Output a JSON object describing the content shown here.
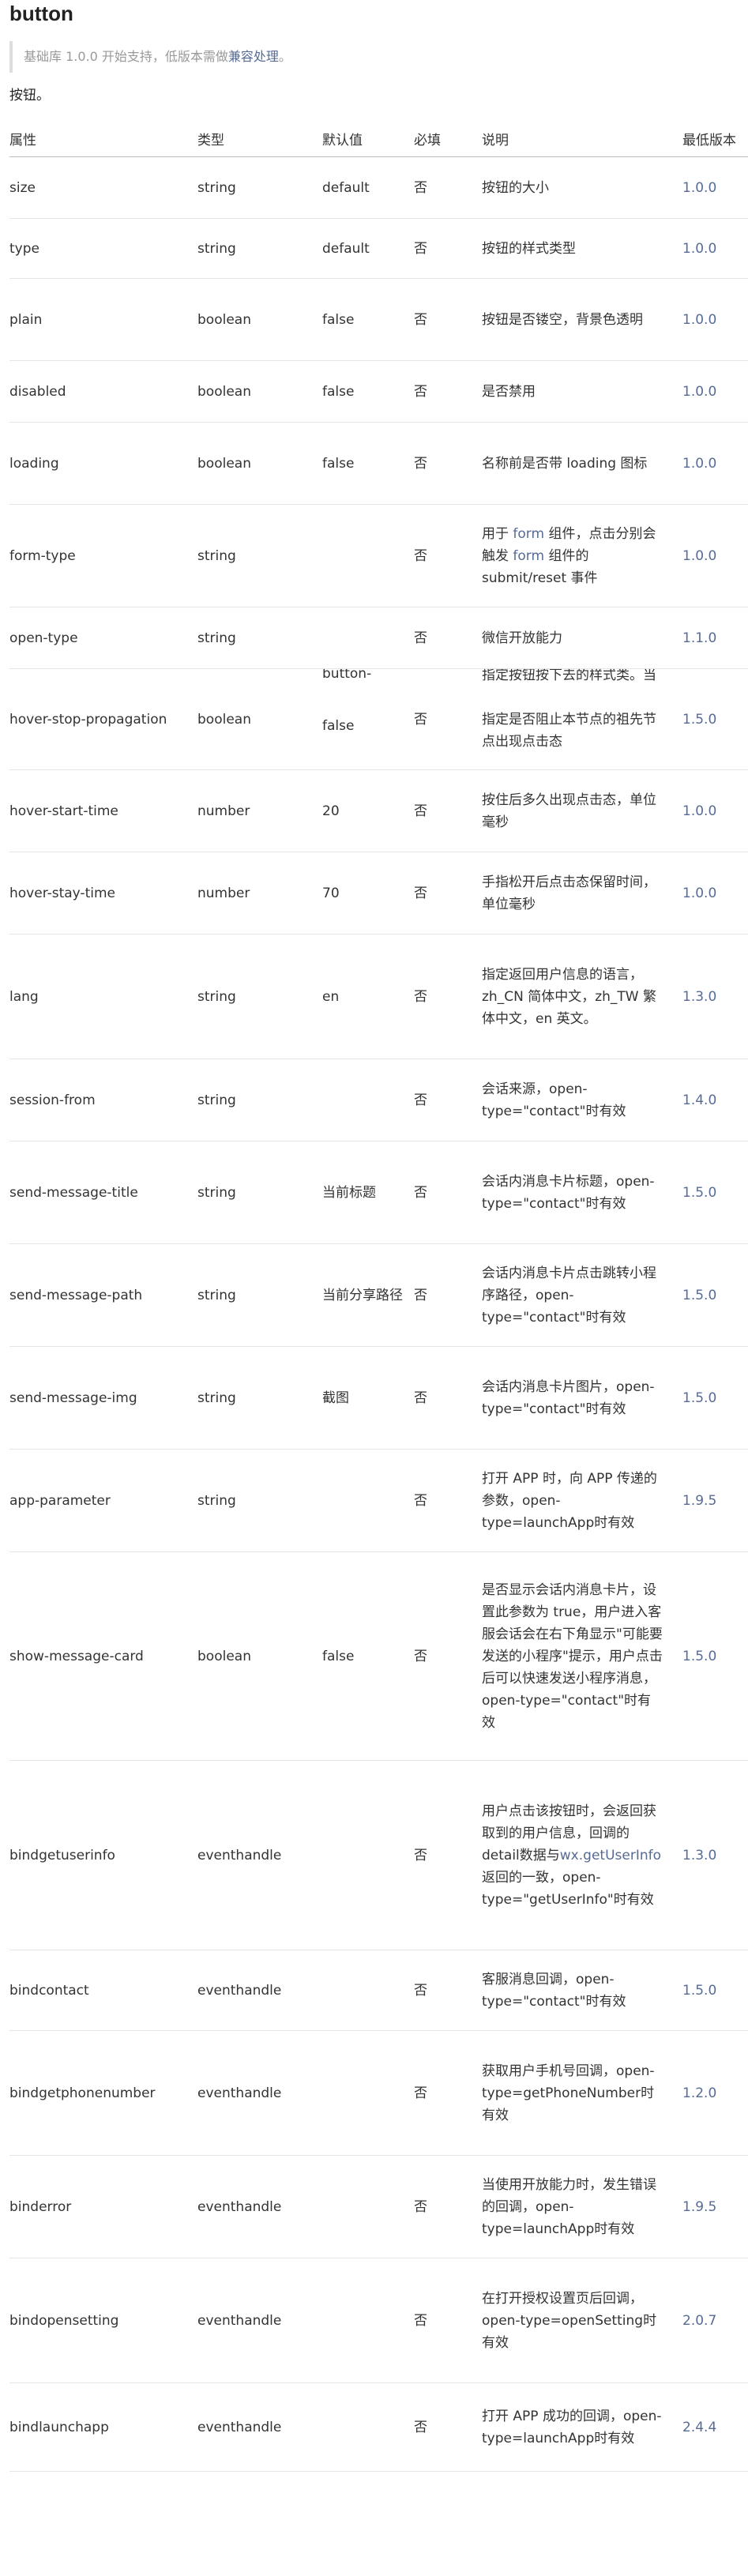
{
  "title": "button",
  "note": {
    "prefix": "基础库 1.0.0 开始支持，低版本需做",
    "link": "兼容处理",
    "suffix": "。"
  },
  "intro": "按钮。",
  "headers": [
    "属性",
    "类型",
    "默认值",
    "必填",
    "说明",
    "最低版本"
  ],
  "rows": [
    {
      "name": "size",
      "type": "string",
      "def": "default",
      "req": "否",
      "desc": "按钮的大小",
      "ver": "1.0.0"
    },
    {
      "name": "type",
      "type": "string",
      "def": "default",
      "req": "否",
      "desc": "按钮的样式类型",
      "ver": "1.0.0"
    },
    {
      "name": "plain",
      "type": "boolean",
      "def": "false",
      "req": "否",
      "desc": "按钮是否镂空，背景色透明",
      "ver": "1.0.0"
    },
    {
      "name": "disabled",
      "type": "boolean",
      "def": "false",
      "req": "否",
      "desc": "是否禁用",
      "ver": "1.0.0"
    },
    {
      "name": "loading",
      "type": "boolean",
      "def": "false",
      "req": "否",
      "desc": "名称前是否带 loading 图标",
      "ver": "1.0.0"
    },
    {
      "name": "form-type",
      "type": "string",
      "def": "",
      "req": "否",
      "desc_parts": [
        "用于 ",
        "form",
        " 组件，点击分别会触发 ",
        "form",
        " 组件的 submit/reset 事件"
      ],
      "ver": "1.0.0"
    },
    {
      "name": "open-type",
      "type": "string",
      "def": "",
      "req": "否",
      "desc": "微信开放能力",
      "ver": "1.1.0"
    },
    {
      "name": "hover-stop-propagation",
      "type": "boolean",
      "def": "false",
      "req": "否",
      "desc": "指定是否阻止本节点的祖先节点出现点击态",
      "ver": "1.5.0",
      "ghost_desc": "指定按钮按下去的样式类。当",
      "ghost_def": "button-"
    },
    {
      "name": "hover-start-time",
      "type": "number",
      "def": "20",
      "req": "否",
      "desc": "按住后多久出现点击态，单位毫秒",
      "ver": "1.0.0"
    },
    {
      "name": "hover-stay-time",
      "type": "number",
      "def": "70",
      "req": "否",
      "desc": "手指松开后点击态保留时间，单位毫秒",
      "ver": "1.0.0"
    },
    {
      "name": "lang",
      "type": "string",
      "def": "en",
      "req": "否",
      "desc": "指定返回用户信息的语言，zh_CN 简体中文，zh_TW 繁体中文，en 英文。",
      "ver": "1.3.0"
    },
    {
      "name": "session-from",
      "type": "string",
      "def": "",
      "req": "否",
      "desc": "会话来源，open-type=\"contact\"时有效",
      "ver": "1.4.0"
    },
    {
      "name": "send-message-title",
      "type": "string",
      "def": "当前标题",
      "req": "否",
      "desc": "会话内消息卡片标题，open-type=\"contact\"时有效",
      "ver": "1.5.0"
    },
    {
      "name": "send-message-path",
      "type": "string",
      "def": "当前分享路径",
      "req": "否",
      "desc": "会话内消息卡片点击跳转小程序路径，open-type=\"contact\"时有效",
      "ver": "1.5.0"
    },
    {
      "name": "send-message-img",
      "type": "string",
      "def": "截图",
      "req": "否",
      "desc": "会话内消息卡片图片，open-type=\"contact\"时有效",
      "ver": "1.5.0"
    },
    {
      "name": "app-parameter",
      "type": "string",
      "def": "",
      "req": "否",
      "desc": "打开 APP 时，向 APP 传递的参数，open-type=launchApp时有效",
      "ver": "1.9.5"
    },
    {
      "name": "show-message-card",
      "type": "boolean",
      "def": "false",
      "req": "否",
      "desc": "是否显示会话内消息卡片，设置此参数为 true，用户进入客服会话会在右下角显示\"可能要发送的小程序\"提示，用户点击后可以快速发送小程序消息，open-type=\"contact\"时有效",
      "ver": "1.5.0"
    },
    {
      "name": "bindgetuserinfo",
      "type": "eventhandle",
      "def": "",
      "req": "否",
      "desc_parts": [
        "用户点击该按钮时，会返回获取到的用户信息，回调的detail数据与",
        "wx.getUserInfo",
        "返回的一致，open-type=\"getUserInfo\"时有效"
      ],
      "ver": "1.3.0"
    },
    {
      "name": "bindcontact",
      "type": "eventhandle",
      "def": "",
      "req": "否",
      "desc": "客服消息回调，open-type=\"contact\"时有效",
      "ver": "1.5.0"
    },
    {
      "name": "bindgetphonenumber",
      "type": "eventhandle",
      "def": "",
      "req": "否",
      "desc": "获取用户手机号回调，open-type=getPhoneNumber时有效",
      "ver": "1.2.0"
    },
    {
      "name": "binderror",
      "type": "eventhandle",
      "def": "",
      "req": "否",
      "desc": "当使用开放能力时，发生错误的回调，open-type=launchApp时有效",
      "ver": "1.9.5"
    },
    {
      "name": "bindopensetting",
      "type": "eventhandle",
      "def": "",
      "req": "否",
      "desc": "在打开授权设置页后回调，open-type=openSetting时有效",
      "ver": "2.0.7"
    },
    {
      "name": "bindlaunchapp",
      "type": "eventhandle",
      "def": "",
      "req": "否",
      "desc": "打开 APP 成功的回调，open-type=launchApp时有效",
      "ver": "2.4.4"
    }
  ]
}
